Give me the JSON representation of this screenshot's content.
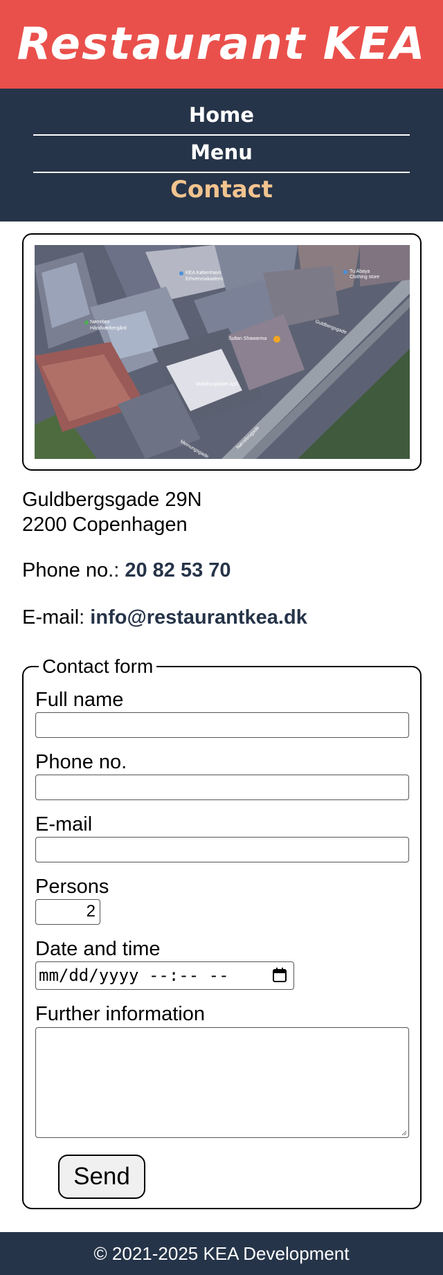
{
  "header": {
    "title": "Restaurant KEA"
  },
  "nav": {
    "items": [
      {
        "label": "Home"
      },
      {
        "label": "Menu"
      },
      {
        "label": "Contact"
      }
    ],
    "active": "Contact"
  },
  "map": {
    "labels": [
      "KEA København",
      "Erhvervsakademi",
      "Nørrebro",
      "Håndværkergård",
      "Sultan Shawarma",
      "Mobilhospitalet ApS",
      "Tu Abaya",
      "Clothing store",
      "Meinungsgade",
      "Nørrebrogade",
      "Guldbergsgade"
    ]
  },
  "contact": {
    "address_line1": "Guldbergsgade 29N",
    "address_line2": "2200 Copenhagen",
    "phone_label": "Phone no.:",
    "phone_value": "20 82 53 70",
    "email_label": "E-mail:",
    "email_value": "info@restaurantkea.dk"
  },
  "form": {
    "legend": "Contact form",
    "full_name_label": "Full name",
    "full_name_value": "",
    "phone_label": "Phone no.",
    "phone_value": "",
    "email_label": "E-mail",
    "email_value": "",
    "persons_label": "Persons",
    "persons_value": "2",
    "datetime_label": "Date and time",
    "datetime_placeholder": "mm/dd/yyyy --:-- --",
    "info_label": "Further information",
    "info_value": "",
    "send_label": "Send"
  },
  "footer": {
    "text": "© 2021-2025 KEA Development"
  },
  "colors": {
    "header_bg": "#ea504b",
    "nav_bg": "#263449",
    "nav_active": "#f2c48f",
    "link_text": "#263449"
  }
}
